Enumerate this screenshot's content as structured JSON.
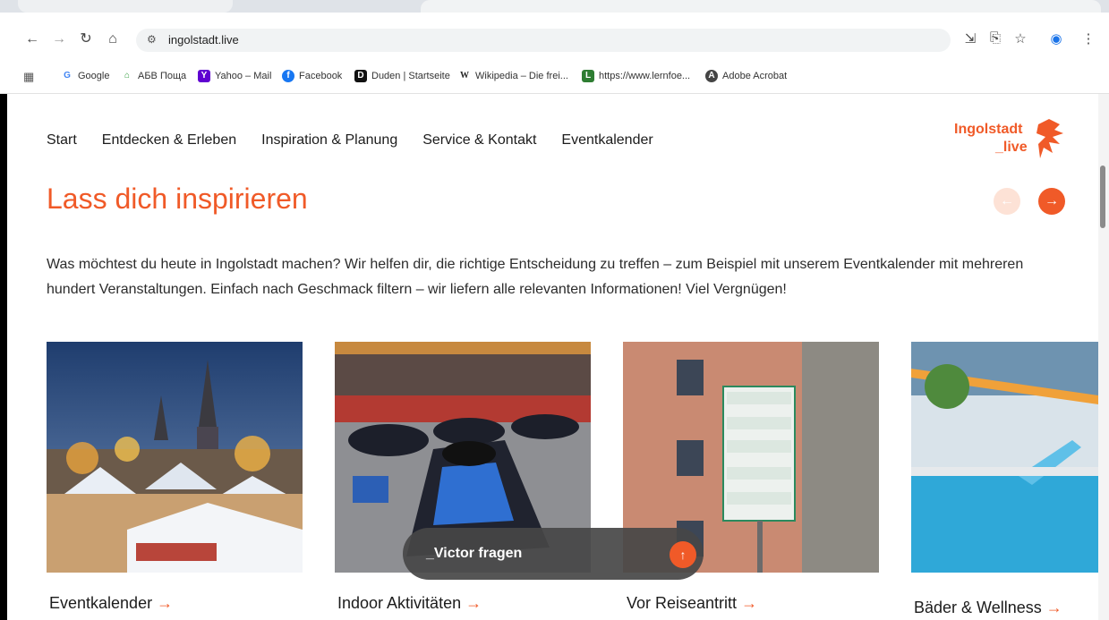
{
  "browser": {
    "url": "ingolstadt.live",
    "bookmarks": [
      {
        "label": "Google",
        "icon": "google-icon"
      },
      {
        "label": "АБВ Поща",
        "icon": "abv-icon"
      },
      {
        "label": "Yahoo – Mail",
        "icon": "yahoo-icon"
      },
      {
        "label": "Facebook",
        "icon": "facebook-icon"
      },
      {
        "label": "Duden | Startseite",
        "icon": "duden-icon"
      },
      {
        "label": "Wikipedia – Die frei...",
        "icon": "wikipedia-icon"
      },
      {
        "label": "https://www.lernfoe...",
        "icon": "lernfoerderung-icon"
      },
      {
        "label": "Adobe Acrobat",
        "icon": "adobe-icon"
      }
    ]
  },
  "site": {
    "nav": [
      "Start",
      "Entdecken & Erleben",
      "Inspiration & Planung",
      "Service & Kontakt",
      "Eventkalender"
    ],
    "logo_line1": "Ingolstadt",
    "logo_line2": "_live",
    "heading": "Lass dich inspirieren",
    "intro": "Was möchtest du heute in Ingolstadt machen? Wir helfen dir, die richtige Entscheidung zu treffen – zum Beispiel mit unserem Eventkalender mit mehreren hundert Veranstaltungen. Einfach nach Geschmack filtern – wir liefern alle relevanten Informationen! Viel Vergnügen!",
    "cards": [
      {
        "label": "Eventkalender",
        "arrow": "→"
      },
      {
        "label": "Indoor Aktivitäten",
        "arrow": "→"
      },
      {
        "label": "Vor Reiseantritt",
        "arrow": "→"
      },
      {
        "label": "Bäder & Wellness",
        "arrow": "→"
      }
    ],
    "chat_label": "_Victor fragen",
    "prev_arrow": "←",
    "next_arrow": "→",
    "up_arrow": "↑"
  },
  "colors": {
    "accent": "#f05a28",
    "accent_light": "#fde2d6"
  }
}
